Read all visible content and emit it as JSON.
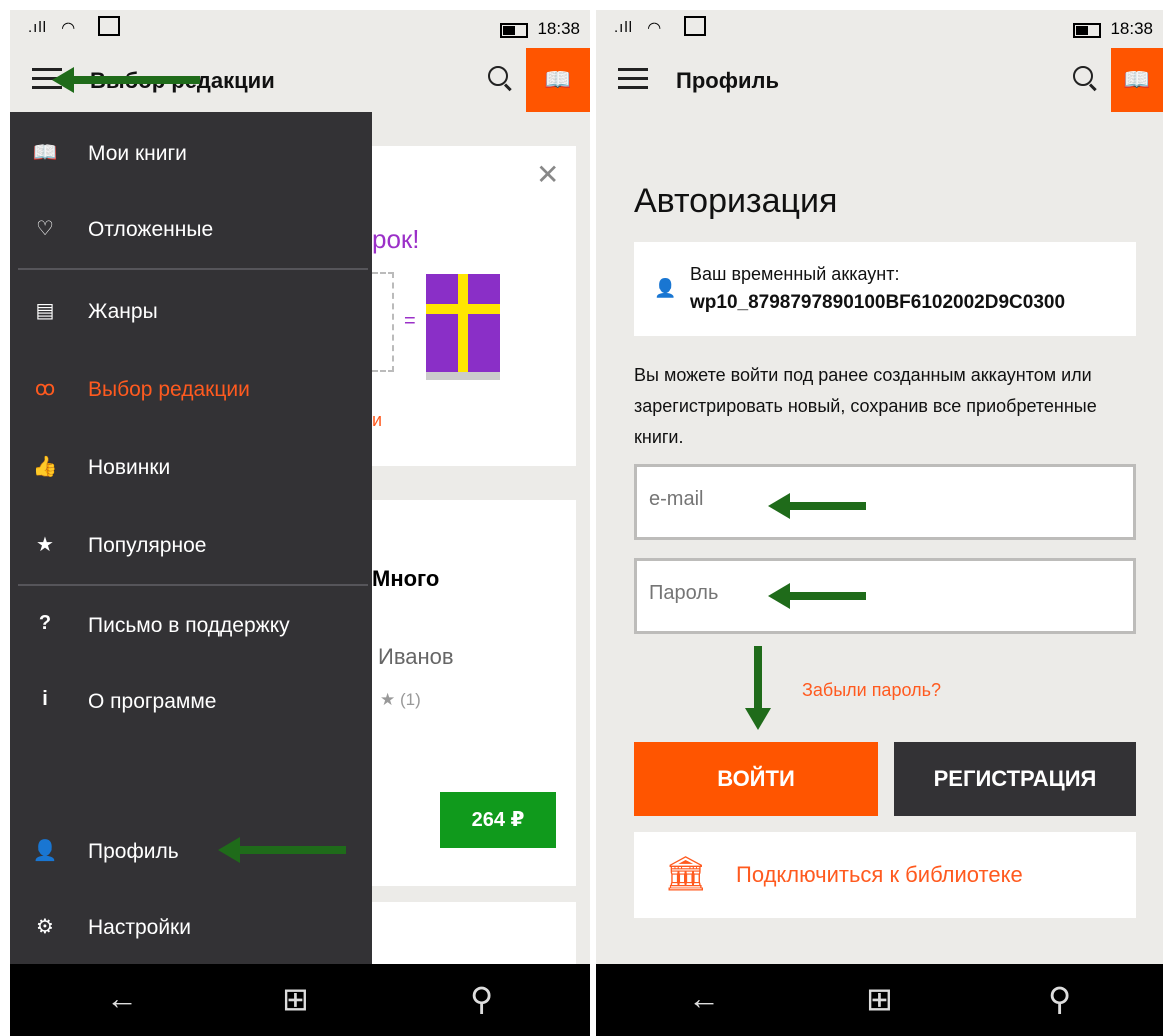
{
  "status": {
    "signal": ".ıll",
    "time": "18:38"
  },
  "left": {
    "title": "Выбор редакции",
    "bg_card": {
      "promo_text": "рок!",
      "equals": "=",
      "red_fragment": "и",
      "book_title": "Много",
      "author": "Иванов",
      "rating": "★ (1)",
      "price": "264 ₽"
    },
    "drawer": {
      "items": [
        {
          "icon": "book-icon",
          "label": "Мои книги"
        },
        {
          "icon": "heart-icon",
          "label": "Отложенные"
        },
        {
          "icon": "genres-icon",
          "label": "Жанры"
        },
        {
          "icon": "glasses-icon",
          "label": "Выбор редакции"
        },
        {
          "icon": "thumbs-up-icon",
          "label": "Новинки"
        },
        {
          "icon": "star-icon",
          "label": "Популярное"
        },
        {
          "icon": "question-icon",
          "label": "Письмо в поддержку"
        },
        {
          "icon": "info-icon",
          "label": "О программе"
        },
        {
          "icon": "person-icon",
          "label": "Профиль"
        },
        {
          "icon": "gear-icon",
          "label": "Настройки"
        }
      ]
    }
  },
  "right": {
    "title": "Профиль",
    "heading": "Авторизация",
    "account_label": "Ваш временный аккаунт:",
    "account_value": "wp10_8798797890100BF6102002D9C0300",
    "description": "Вы можете войти под ранее созданным аккаунтом или зарегистрировать новый, сохранив все приобретенные книги.",
    "email_placeholder": "e-mail",
    "password_placeholder": "Пароль",
    "forgot": "Забыли пароль?",
    "login": "ВОЙТИ",
    "register": "РЕГИСТРАЦИЯ",
    "library": "Подключиться к библиотеке"
  },
  "colors": {
    "accent": "#ff5500",
    "drawer": "#333235",
    "price": "#109a1c",
    "arrow": "#1f6b1a",
    "dark_button": "#333235"
  }
}
